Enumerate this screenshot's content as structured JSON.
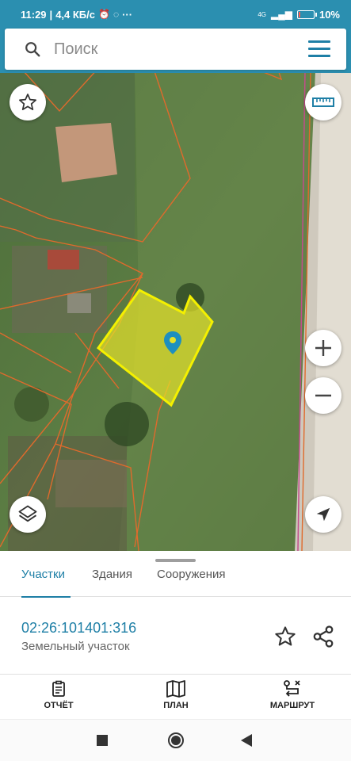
{
  "status_bar": {
    "time": "11:29",
    "speed": "4,4 КБ/с",
    "extra": "···",
    "battery_text": "10%",
    "battery_level": 0.1,
    "network": "4G"
  },
  "search": {
    "placeholder": "Поиск"
  },
  "map": {
    "parcel_fill_color": "#e6e22a",
    "parcel_border_color": "#f4f000",
    "boundary_color": "#e06a2c",
    "marker_color": "#1e8fbf"
  },
  "tabs": [
    {
      "label": "Участки",
      "active": true
    },
    {
      "label": "Здания",
      "active": false
    },
    {
      "label": "Сооружения",
      "active": false
    }
  ],
  "parcel": {
    "cadastral_number": "02:26:101401:316",
    "type": "Земельный участок"
  },
  "actions": [
    {
      "label": "ОТЧЁТ",
      "icon": "report-icon"
    },
    {
      "label": "ПЛАН",
      "icon": "map-icon"
    },
    {
      "label": "МАРШРУТ",
      "icon": "route-icon"
    }
  ],
  "colors": {
    "accent": "#1e7fa6",
    "header": "#2b8fb0"
  }
}
